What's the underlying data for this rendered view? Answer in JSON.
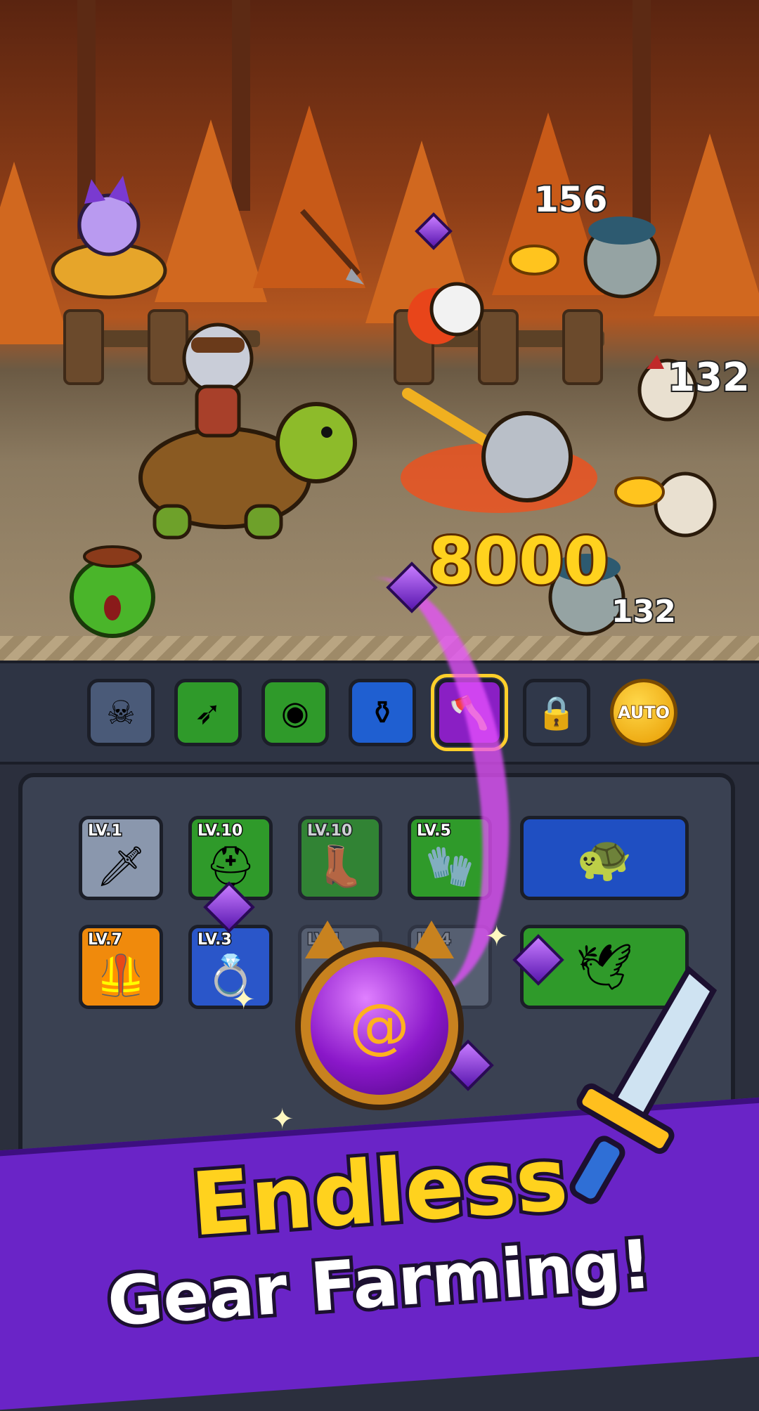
{
  "scene": {
    "damage_numbers": [
      "156",
      "132",
      "132"
    ],
    "big_damage": "8000"
  },
  "skillbar": {
    "skills": [
      {
        "name": "skull-skill-icon",
        "color": "#4a5a78"
      },
      {
        "name": "arrows-skill-icon",
        "color": "#2f9a2a"
      },
      {
        "name": "disco-ball-skill-icon",
        "color": "#2f9a2a"
      },
      {
        "name": "cauldron-skill-icon",
        "color": "#1f5fd1"
      },
      {
        "name": "flaming-axe-skill-icon",
        "color": "#8a1fc4"
      },
      {
        "name": "lock-icon",
        "color": "#30384a"
      }
    ],
    "auto_label": "AUTO"
  },
  "inventory": {
    "row1": [
      {
        "level": "LV.1",
        "icon": "sword-icon",
        "color": "#8a97ad"
      },
      {
        "level": "LV.10",
        "icon": "viking-helmet-icon",
        "color": "#2f9a2a"
      },
      {
        "level": "LV.10",
        "icon": "boot-icon",
        "color": "#2f9a2a"
      },
      {
        "level": "LV.5",
        "icon": "glove-icon",
        "color": "#2f9a2a"
      }
    ],
    "row2": [
      {
        "level": "LV.7",
        "icon": "armor-icon",
        "color": "#f08a0c"
      },
      {
        "level": "LV.3",
        "icon": "ring-icon",
        "color": "#2a56c9"
      },
      {
        "level": "LV.1",
        "icon": "gem-item-icon",
        "color": "#8a97ad"
      },
      {
        "level": "LV.4",
        "icon": "necklace-icon",
        "color": "#8a97ad"
      }
    ],
    "pet_turtle_color": "#1f4fc2",
    "pet_wings_color": "#2f9a2a"
  },
  "banner": {
    "line1": "Endless",
    "line2": "Gear Farming!"
  }
}
